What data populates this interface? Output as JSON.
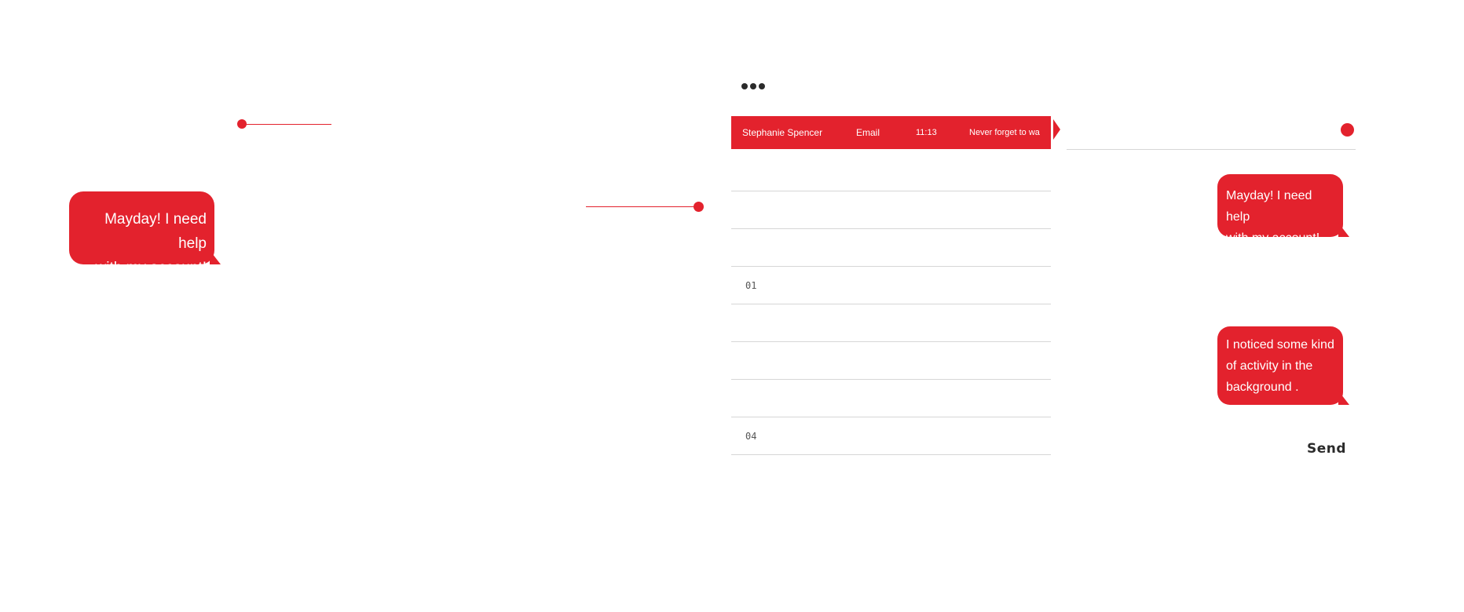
{
  "theme": {
    "accent": "#e3222d"
  },
  "left_bubble": {
    "line1": "Mayday! I need help",
    "line2": "with my account!"
  },
  "list": {
    "selected_row": {
      "name": "Stephanie Spencer",
      "channel": "Email",
      "time": "11:13",
      "preview": "Never forget to wa"
    },
    "row_numbers": {
      "row4": "01",
      "row8": "04"
    }
  },
  "chat": {
    "messages": [
      {
        "line1": "Mayday! I need help",
        "line2": "with my account!"
      },
      {
        "line1": "I noticed some kind",
        "line2": "of activity in the",
        "line3": "background ."
      }
    ],
    "send_label": "Send"
  },
  "icons": {
    "menu": "more-dots-icon",
    "status": "status-dot-icon"
  }
}
